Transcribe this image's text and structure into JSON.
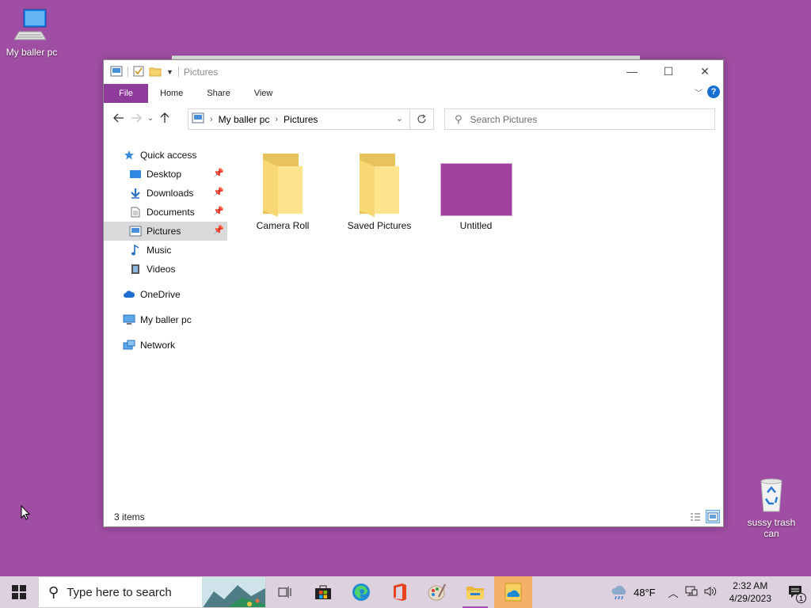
{
  "desktop": {
    "icons": [
      {
        "label": "My baller pc",
        "icon": "computer-icon"
      },
      {
        "label": "sussy trash\ncan",
        "icon": "recycle-bin-icon"
      }
    ],
    "background_color": "#a04ea3"
  },
  "window": {
    "title": "Pictures",
    "controls": {
      "minimize": "—",
      "maximize": "☐",
      "close": "✕"
    },
    "ribbon": {
      "tabs": [
        "File",
        "Home",
        "Share",
        "View"
      ],
      "file_tab_color": "#8e3b9c",
      "help": "?"
    },
    "address": {
      "crumbs": [
        "My baller pc",
        "Pictures"
      ]
    },
    "search": {
      "placeholder": "Search Pictures"
    },
    "nav_pane": {
      "quick_access": "Quick access",
      "pinned": [
        "Desktop",
        "Downloads",
        "Documents",
        "Pictures"
      ],
      "unpinned": [
        "Music",
        "Videos"
      ],
      "roots": [
        "OneDrive",
        "My baller pc",
        "Network"
      ],
      "selected": "Pictures"
    },
    "items": [
      {
        "name": "Camera Roll",
        "type": "folder"
      },
      {
        "name": "Saved Pictures",
        "type": "folder"
      },
      {
        "name": "Untitled",
        "type": "image",
        "color": "#a0409f"
      }
    ],
    "status": "3 items"
  },
  "taskbar": {
    "search_placeholder": "Type here to search",
    "apps": [
      "task-view",
      "microsoft-store",
      "edge",
      "office",
      "paint",
      "file-explorer",
      "photos"
    ],
    "weather": "48°F",
    "time": "2:32 AM",
    "date": "4/29/2023",
    "notification_count": "1"
  }
}
